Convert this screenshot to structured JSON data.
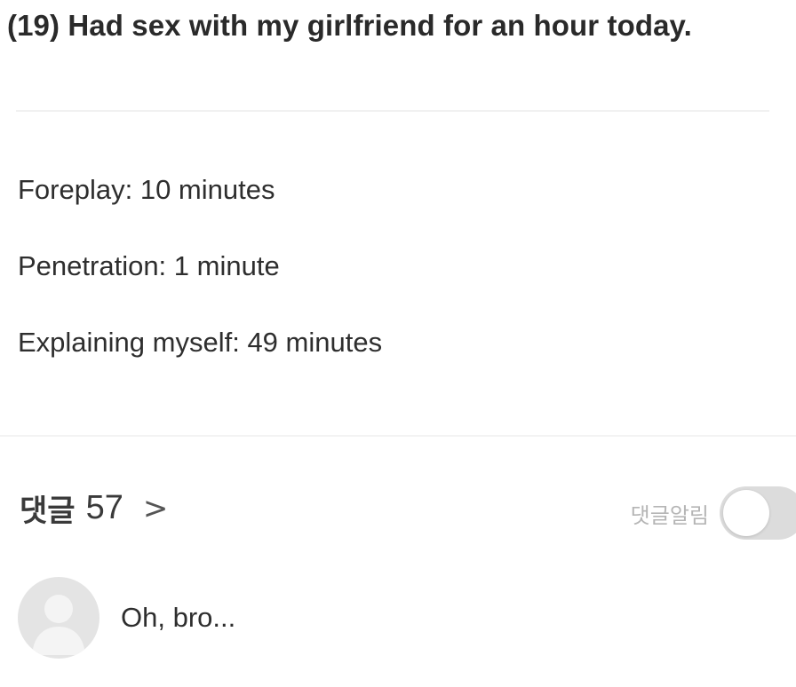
{
  "post": {
    "title": "(19) Had sex with my girlfriend for an hour today.",
    "lines": [
      "Foreplay: 10 minutes",
      "Penetration: 1 minute",
      "Explaining myself: 49 minutes"
    ]
  },
  "comments": {
    "label": "댓글",
    "count": "57",
    "chevron": ">",
    "notify_label": "댓글알림",
    "notify_enabled": false,
    "items": [
      {
        "avatar_icon": "default-user-avatar-icon",
        "text": "Oh, bro..."
      }
    ]
  },
  "colors": {
    "text": "#2e2e2e",
    "muted": "#b5b5b5",
    "toggle_off": "#dcdcdc",
    "avatar_bg": "#e4e4e4"
  }
}
